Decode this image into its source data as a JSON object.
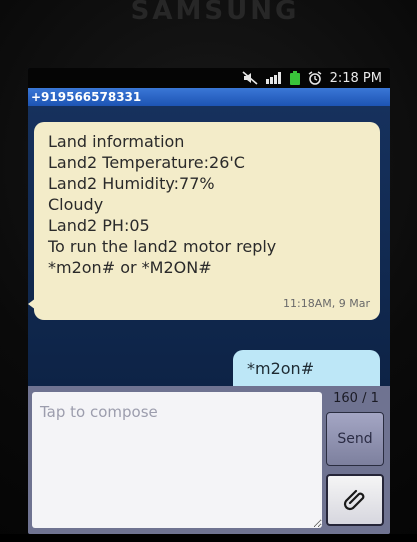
{
  "device": {
    "brand": "SAMSUNG"
  },
  "status_bar": {
    "time": "2:18 PM",
    "icons": [
      "mute-icon",
      "signal-icon",
      "battery-icon",
      "alarm-icon"
    ],
    "colors": {
      "battery": "#39c43a"
    }
  },
  "conversation": {
    "contact": "+919566578331",
    "header_color": "#2b62c4",
    "messages_in": [
      {
        "lines": [
          "Land information",
          "Land2 Temperature:26'C",
          "Land2 Humidity:77%",
          "Cloudy",
          "Land2 PH:05",
          "To run the land2 motor reply",
          "*m2on# or *M2ON#"
        ],
        "timestamp": "11:18AM, 9 Mar"
      }
    ],
    "messages_out": [
      {
        "text": "*m2on#"
      }
    ]
  },
  "compose": {
    "placeholder": "Tap to compose",
    "counter": "160 / 1",
    "send_label": "Send",
    "attach_icon": "paperclip-icon"
  }
}
